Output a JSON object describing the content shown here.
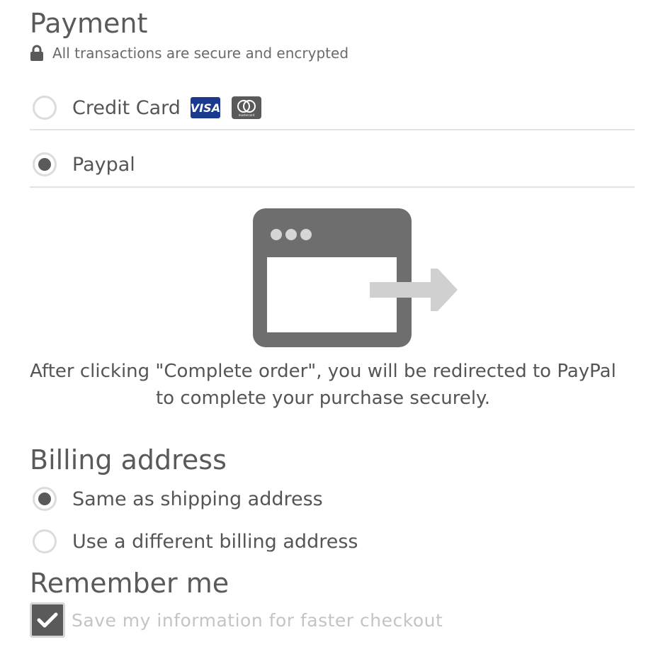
{
  "payment": {
    "title": "Payment",
    "secure_note": "All transactions are secure and encrypted",
    "methods": [
      {
        "label": "Credit Card",
        "selected": false,
        "card_icons": [
          "visa-icon",
          "mastercard-icon"
        ],
        "visa_text": "VISA",
        "mastercard_text": "mastercard"
      },
      {
        "label": "Paypal",
        "selected": true
      }
    ],
    "redirect_message_line1": "After clicking \"Complete order\", you will be redirected to PayPal",
    "redirect_message_line2": "to complete your purchase securely."
  },
  "billing": {
    "title": "Billing address",
    "options": [
      {
        "label": "Same as shipping address",
        "selected": true
      },
      {
        "label": "Use a different billing address",
        "selected": false
      }
    ]
  },
  "remember": {
    "title": "Remember me",
    "checkbox_label": "Save my information for faster checkout",
    "checked": true
  },
  "colors": {
    "primary_gray": "#5a5a5a",
    "border_gray": "#dcdcdc",
    "divider_gray": "#e4e4e4",
    "visa_blue": "#1a3a8f",
    "muted_text": "#c4c4c4"
  }
}
